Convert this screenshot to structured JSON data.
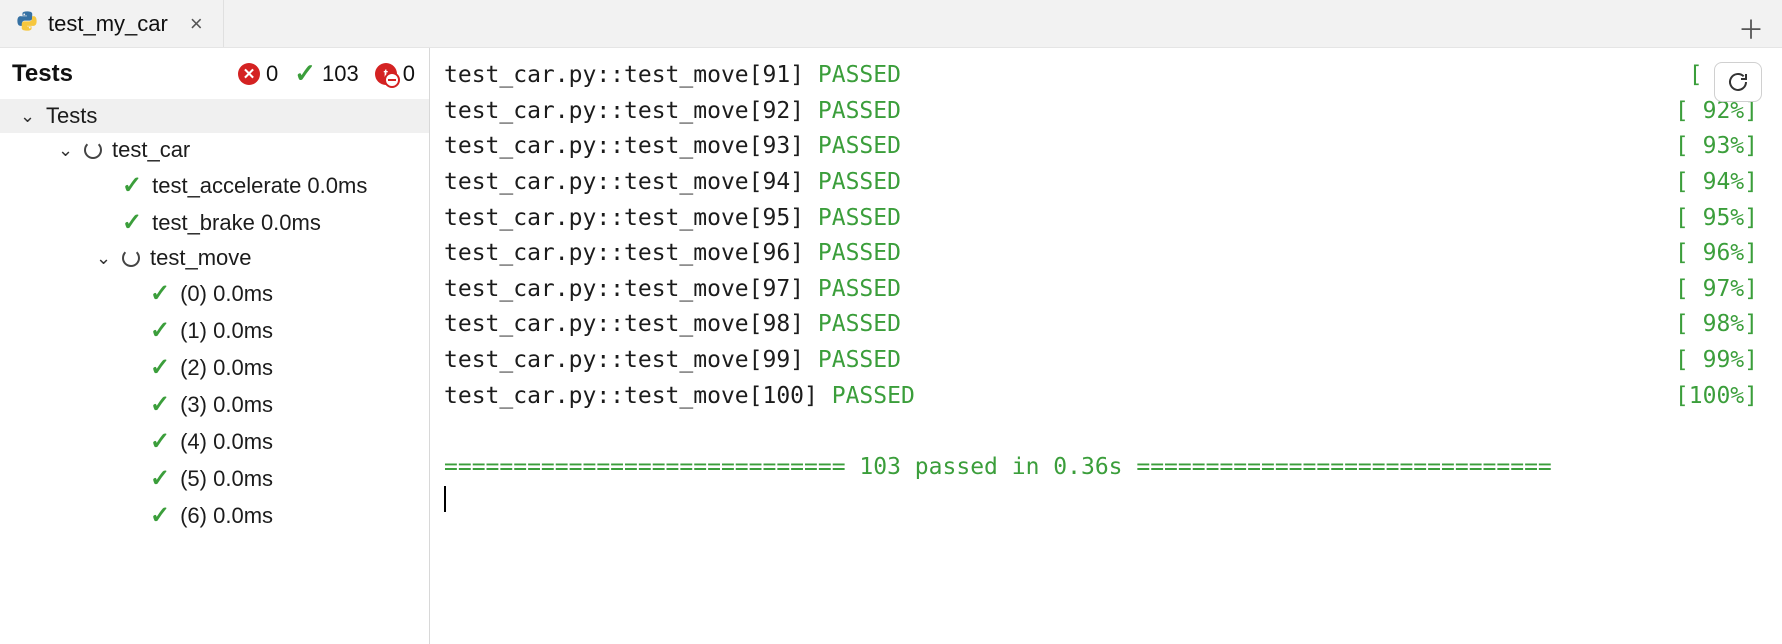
{
  "tab": {
    "label": "test_my_car"
  },
  "sidebar": {
    "title": "Tests",
    "failed_count": "0",
    "passed_count": "103",
    "ignored_count": "0",
    "root_label": "Tests",
    "suite_label": "test_car",
    "test_accelerate": "test_accelerate 0.0ms",
    "test_brake": "test_brake 0.0ms",
    "test_move_label": "test_move",
    "move_items": [
      "(0) 0.0ms",
      "(1) 0.0ms",
      "(2) 0.0ms",
      "(3) 0.0ms",
      "(4) 0.0ms",
      "(5) 0.0ms",
      "(6) 0.0ms"
    ]
  },
  "console": {
    "lines": [
      {
        "text": "test_car.py::test_move[91] ",
        "status": "PASSED",
        "pct": "[    "
      },
      {
        "text": "test_car.py::test_move[92] ",
        "status": "PASSED",
        "pct": "[ 92%]"
      },
      {
        "text": "test_car.py::test_move[93] ",
        "status": "PASSED",
        "pct": "[ 93%]"
      },
      {
        "text": "test_car.py::test_move[94] ",
        "status": "PASSED",
        "pct": "[ 94%]"
      },
      {
        "text": "test_car.py::test_move[95] ",
        "status": "PASSED",
        "pct": "[ 95%]"
      },
      {
        "text": "test_car.py::test_move[96] ",
        "status": "PASSED",
        "pct": "[ 96%]"
      },
      {
        "text": "test_car.py::test_move[97] ",
        "status": "PASSED",
        "pct": "[ 97%]"
      },
      {
        "text": "test_car.py::test_move[98] ",
        "status": "PASSED",
        "pct": "[ 98%]"
      },
      {
        "text": "test_car.py::test_move[99] ",
        "status": "PASSED",
        "pct": "[ 99%]"
      },
      {
        "text": "test_car.py::test_move[100] ",
        "status": "PASSED",
        "pct": "[100%]"
      }
    ],
    "summary": "============================= 103 passed in 0.36s =============================="
  }
}
